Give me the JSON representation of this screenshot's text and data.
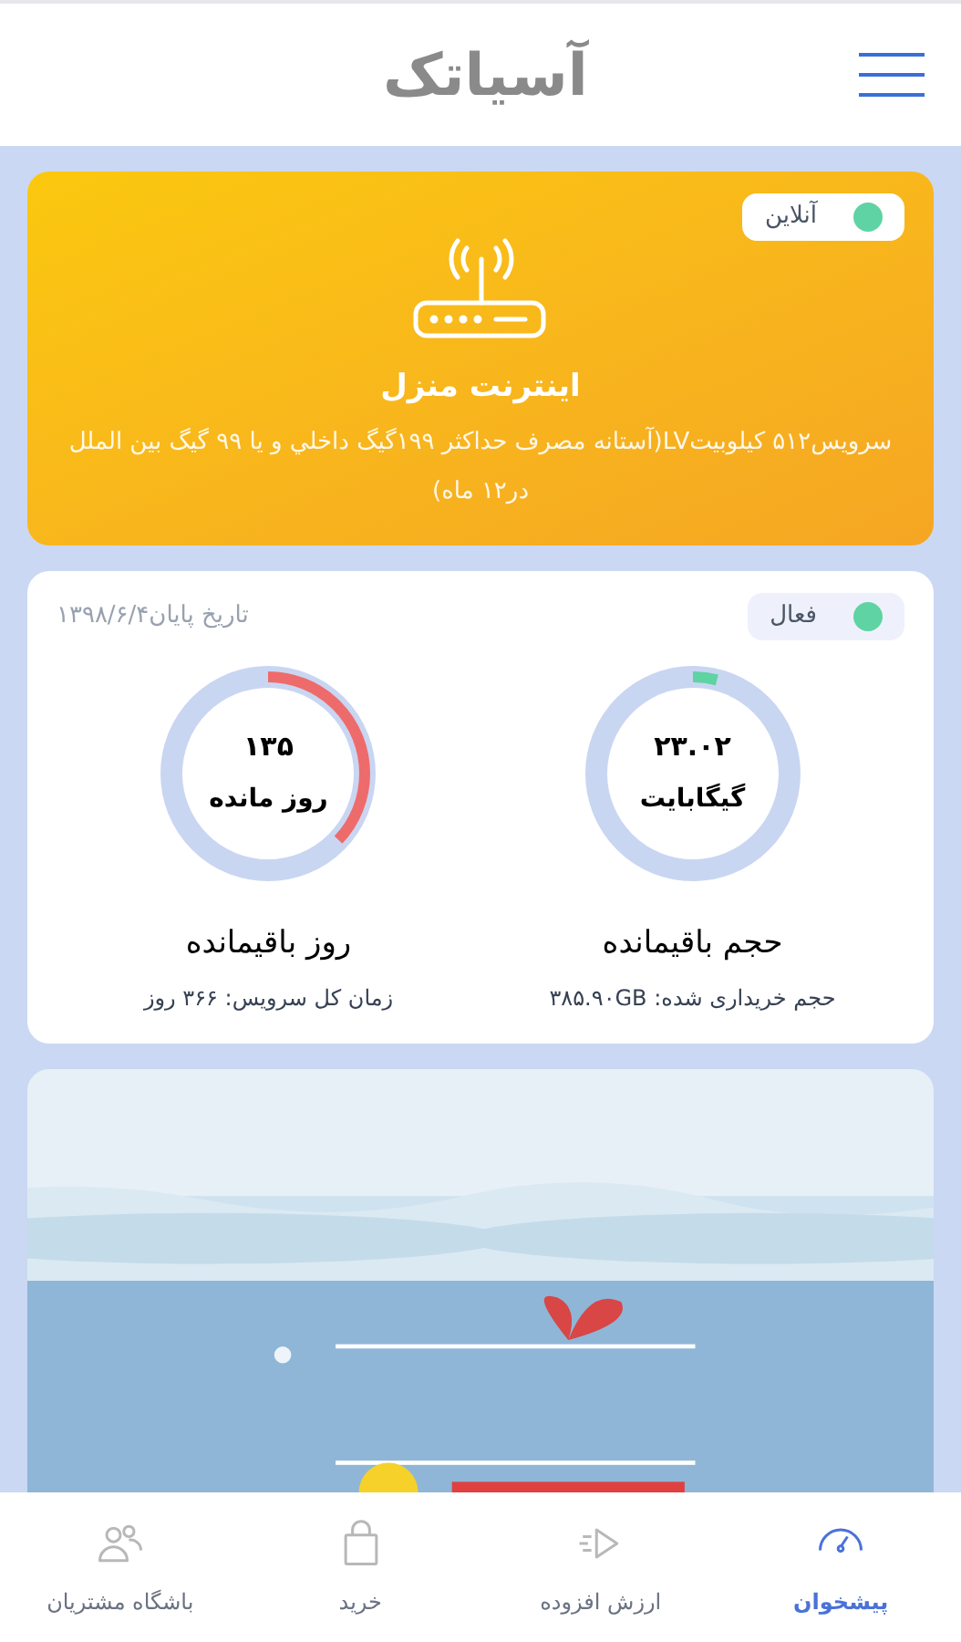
{
  "header": {
    "logo": "آسیاتک"
  },
  "service_card": {
    "status": {
      "label": "آنلاین",
      "color": "#5fd3a3"
    },
    "title": "اینترنت منزل",
    "description": "سرویس۵۱۲ کیلوبیتLV(آستانه مصرف حداکثر ۱۹۹گیگ داخلي و يا ۹۹ گیگ بین الملل در۱۲ ماه)"
  },
  "usage_card": {
    "status": {
      "label": "فعال",
      "color": "#5fd3a3"
    },
    "end_date": "تاریخ پایان۱۳۹۸/۶/۴",
    "gauges": [
      {
        "value": "۲۳.۰۲",
        "unit": "گیگابایت",
        "level": 0.04,
        "color": "#5fd3a3",
        "title": "حجم باقیمانده",
        "detail": "حجم خریداری شده: ۳۸۵.۹۰GB"
      },
      {
        "value": "۱۳۵",
        "unit": "روز مانده",
        "level": 0.37,
        "color": "#ee6b6b",
        "title": "روز باقیمانده",
        "detail": "زمان کل سرویس: ۳۶۶ روز"
      }
    ]
  },
  "bottom_nav": [
    {
      "label": "پیشخوان",
      "kind": "dashboard",
      "selected": true
    },
    {
      "label": "ارزش افزوده",
      "kind": "addons",
      "selected": false
    },
    {
      "label": "خرید",
      "kind": "shop",
      "selected": false
    },
    {
      "label": "باشگاه مشتریان",
      "kind": "club",
      "selected": false
    }
  ]
}
